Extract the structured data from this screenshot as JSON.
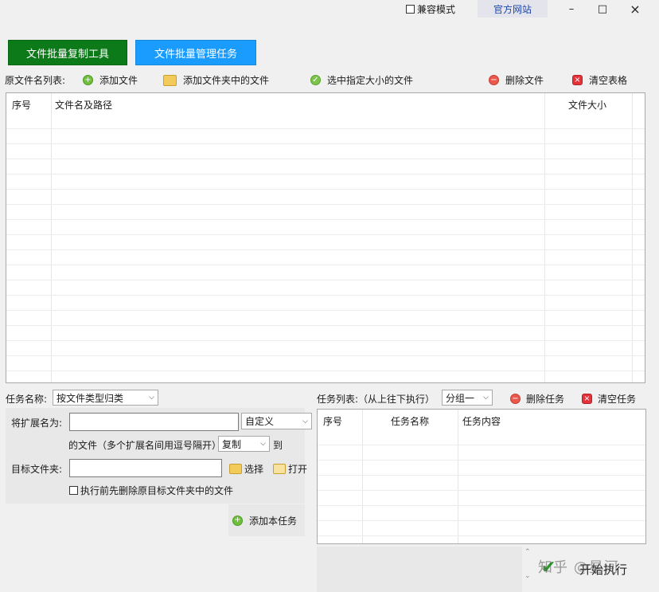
{
  "titlebar": {
    "compat_label": "兼容模式",
    "website_label": "官方网站",
    "minimize_glyph": "–",
    "maximize_glyph": "□",
    "close_glyph": "×"
  },
  "tabs": {
    "copy_tool": "文件批量复制工具",
    "manage_tasks": "文件批量管理任务"
  },
  "toolbar": {
    "list_label": "原文件名列表:",
    "add_file": "添加文件",
    "add_folder_files": "添加文件夹中的文件",
    "select_by_size": "选中指定大小的文件",
    "delete_file": "删除文件",
    "clear_table": "清空表格"
  },
  "file_table": {
    "columns": [
      "序号",
      "文件名及路径",
      "文件大小"
    ],
    "rows": []
  },
  "task_form": {
    "task_name_label": "任务名称:",
    "task_name_value": "按文件类型归类",
    "ext_label": "将扩展名为:",
    "ext_value": "",
    "ext_mode_value": "自定义",
    "files_hint": "的文件（多个扩展名间用逗号隔开）",
    "action_value": "复制",
    "to_label": "到",
    "target_label": "目标文件夹:",
    "target_value": "",
    "choose_label": "选择",
    "open_label": "打开",
    "pre_delete_label": "执行前先删除原目标文件夹中的文件",
    "add_task_label": "添加本任务"
  },
  "task_list": {
    "label": "任务列表:（从上往下执行）",
    "group_value": "分组一",
    "delete_task": "删除任务",
    "clear_task": "清空任务",
    "columns": [
      "序号",
      "任务名称",
      "任务内容"
    ],
    "rows": []
  },
  "start_label": "开始执行",
  "watermark": "知乎 @星河"
}
